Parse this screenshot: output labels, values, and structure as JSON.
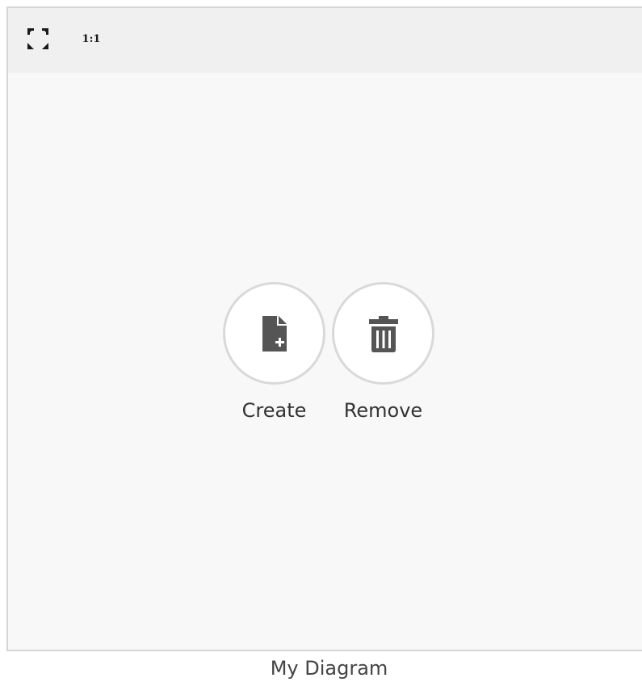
{
  "toolbar": {
    "fullscreen_icon": "fullscreen-icon",
    "zoom_reset_label": "1:1"
  },
  "actions": [
    {
      "label": "Create",
      "icon": "new-document-icon"
    },
    {
      "label": "Remove",
      "icon": "trash-icon"
    }
  ],
  "caption": "My Diagram",
  "colors": {
    "canvas_background": "#f8f8f8",
    "toolbar_background": "#f0f0f0",
    "border": "#d6d6d6",
    "icon": "#555555",
    "label_text": "#333333"
  }
}
